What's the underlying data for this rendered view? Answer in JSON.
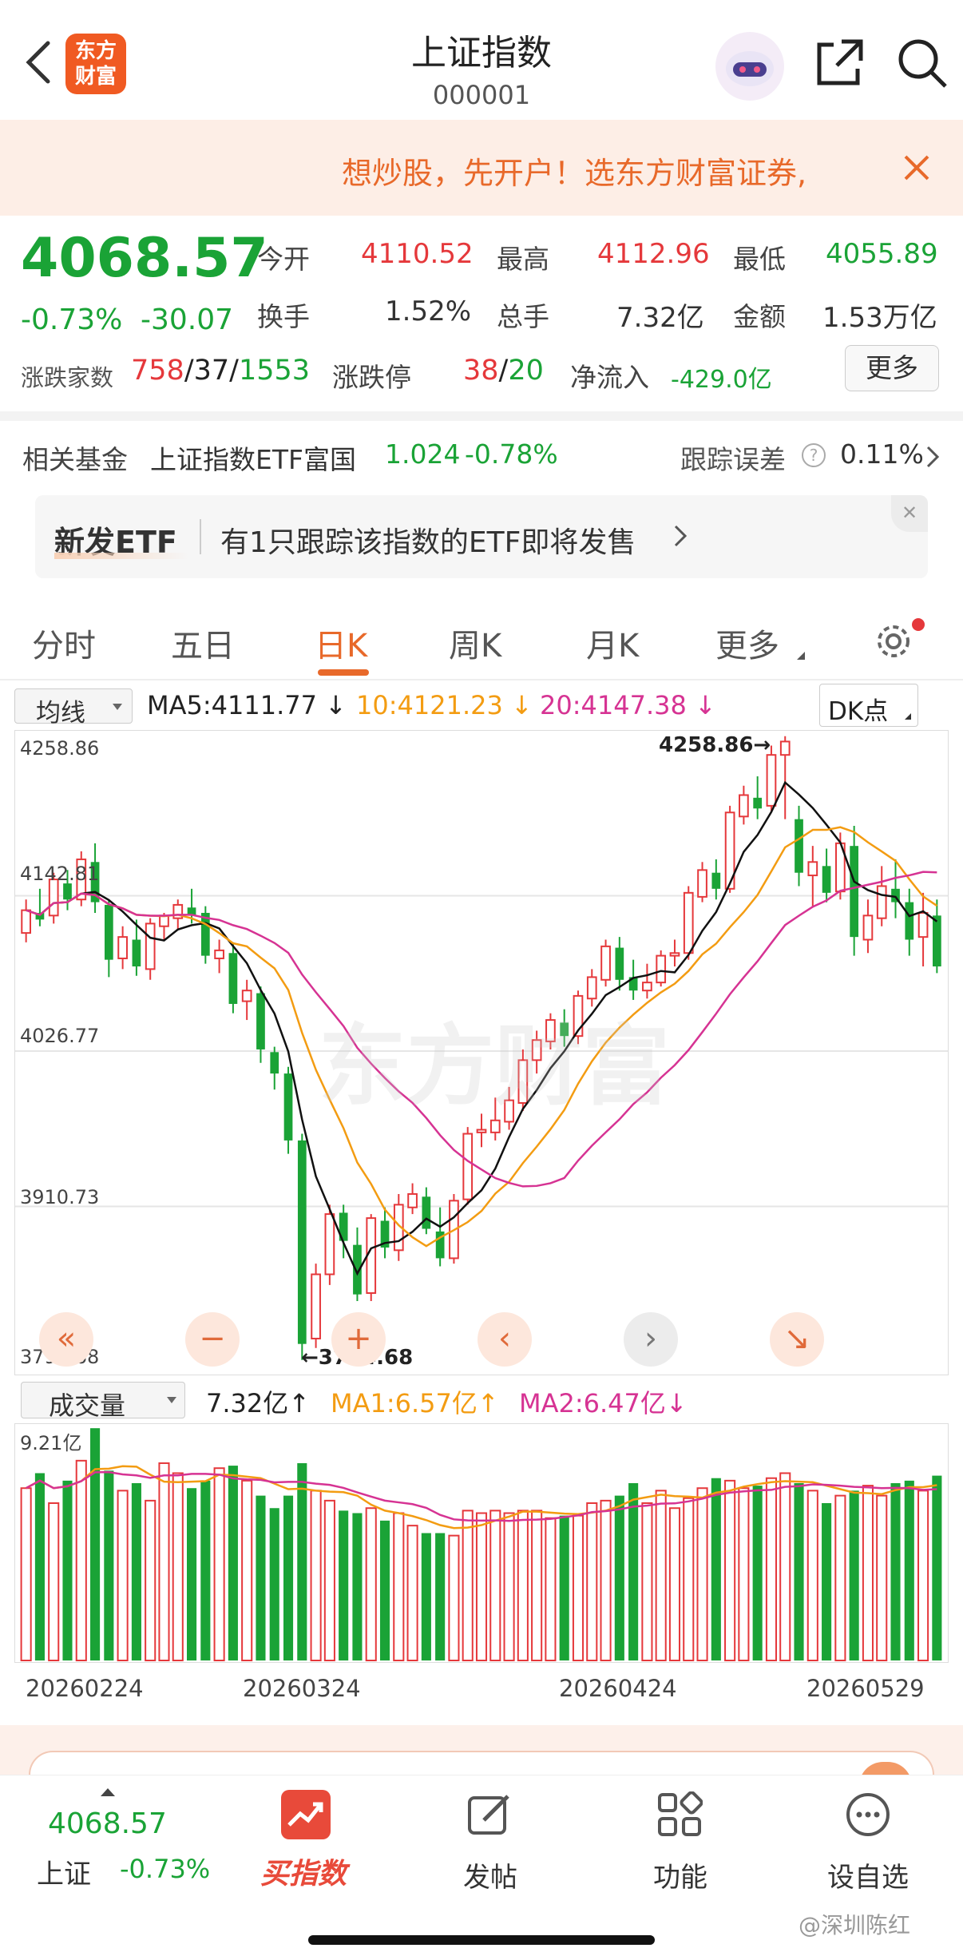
{
  "header": {
    "back_icon": "chevron-left-icon",
    "app_logo_text": "东方财富",
    "title": "上证指数",
    "code": "000001",
    "share_icon": "share-icon",
    "search_icon": "search-icon"
  },
  "banner": {
    "text": "想炒股，先开户！选东方财富证券,",
    "close_icon": "close-icon"
  },
  "quote": {
    "price": "4068.57",
    "change_pct": "-0.73%",
    "change": "-30.07",
    "open_label": "今开",
    "open": "4110.52",
    "high_label": "最高",
    "high": "4112.96",
    "low_label": "最低",
    "low": "4055.89",
    "turnover_label": "换手",
    "turnover": "1.52%",
    "volume_label": "总手",
    "volume": "7.32亿",
    "amount_label": "金额",
    "amount": "1.53万亿",
    "updown_label": "涨跌家数",
    "up_count": "758",
    "flat_count": "37",
    "down_count": "1553",
    "limit_label": "涨跌停",
    "limit_up": "38",
    "limit_down": "20",
    "netflow_label": "净流入",
    "netflow": "-429.0亿",
    "more_button": "更多",
    "slash": "/"
  },
  "fund": {
    "label": "相关基金",
    "name": "上证指数ETF富国",
    "price": "1.024",
    "change": "-0.78%",
    "tracking_label": "跟踪误差",
    "tracking_value": "0.11%"
  },
  "etf_card": {
    "tag": "新发ETF",
    "text": "有1只跟踪该指数的ETF即将发售"
  },
  "tabs": [
    {
      "label": "分时"
    },
    {
      "label": "五日"
    },
    {
      "label": "日K"
    },
    {
      "label": "周K"
    },
    {
      "label": "月K"
    },
    {
      "label": "更多"
    }
  ],
  "active_tab": "日K",
  "ma_bar": {
    "select_label": "均线",
    "ma5": "MA5:4111.77",
    "ma10": "10:4121.23",
    "ma20": "20:4147.38",
    "dk_label": "DK点"
  },
  "vol_bar": {
    "select_label": "成交量",
    "vol": "7.32亿",
    "ma1": "MA1:6.57亿",
    "ma2": "MA2:6.47亿"
  },
  "chart_controls": [
    "«",
    "−",
    "+",
    "‹",
    "›",
    "↘"
  ],
  "chart_data": [
    {
      "type": "candlestick",
      "y_ticks": [
        "4258.86",
        "4142.81",
        "4026.77",
        "3910.73",
        "3794.68"
      ],
      "ylim": [
        3794.68,
        4258.86
      ],
      "watermark": "东方财富",
      "high_marker": "4258.86",
      "low_marker": "3794.68",
      "candles": [
        [
          4115,
          4132,
          4140,
          4108
        ],
        [
          4130,
          4125,
          4148,
          4120
        ],
        [
          4128,
          4155,
          4160,
          4122
        ],
        [
          4152,
          4140,
          4162,
          4132
        ],
        [
          4140,
          4170,
          4176,
          4135
        ],
        [
          4168,
          4138,
          4182,
          4130
        ],
        [
          4136,
          4095,
          4140,
          4082
        ],
        [
          4096,
          4112,
          4120,
          4088
        ],
        [
          4110,
          4090,
          4125,
          4083
        ],
        [
          4088,
          4122,
          4126,
          4080
        ],
        [
          4120,
          4128,
          4130,
          4110
        ],
        [
          4126,
          4136,
          4140,
          4118
        ],
        [
          4134,
          4128,
          4148,
          4122
        ],
        [
          4130,
          4098,
          4135,
          4092
        ],
        [
          4096,
          4102,
          4110,
          4085
        ],
        [
          4100,
          4062,
          4108,
          4055
        ],
        [
          4064,
          4072,
          4080,
          4050
        ],
        [
          4070,
          4028,
          4075,
          4018
        ],
        [
          4026,
          4010,
          4030,
          3998
        ],
        [
          4010,
          3960,
          4015,
          3950
        ],
        [
          3960,
          3808,
          3965,
          3796
        ],
        [
          3812,
          3860,
          3868,
          3805
        ],
        [
          3860,
          3905,
          3912,
          3852
        ],
        [
          3906,
          3885,
          3912,
          3872
        ],
        [
          3882,
          3845,
          3895,
          3840
        ],
        [
          3846,
          3902,
          3905,
          3840
        ],
        [
          3900,
          3880,
          3910,
          3872
        ],
        [
          3878,
          3912,
          3920,
          3870
        ],
        [
          3910,
          3920,
          3928,
          3905
        ],
        [
          3918,
          3894,
          3925,
          3890
        ],
        [
          3892,
          3872,
          3910,
          3866
        ],
        [
          3872,
          3915,
          3920,
          3868
        ],
        [
          3916,
          3965,
          3970,
          3912
        ],
        [
          3966,
          3968,
          3980,
          3955
        ],
        [
          3966,
          3975,
          3992,
          3960
        ],
        [
          3974,
          3990,
          4000,
          3968
        ],
        [
          3988,
          4020,
          4028,
          3982
        ],
        [
          4020,
          4035,
          4042,
          4010
        ],
        [
          4034,
          4050,
          4055,
          4028
        ],
        [
          4048,
          4038,
          4058,
          4030
        ],
        [
          4038,
          4068,
          4072,
          4032
        ],
        [
          4066,
          4082,
          4088,
          4060
        ],
        [
          4080,
          4105,
          4110,
          4075
        ],
        [
          4104,
          4080,
          4112,
          4072
        ],
        [
          4082,
          4072,
          4095,
          4065
        ],
        [
          4072,
          4078,
          4092,
          4066
        ],
        [
          4078,
          4098,
          4102,
          4075
        ],
        [
          4098,
          4100,
          4110,
          4090
        ],
        [
          4100,
          4145,
          4150,
          4095
        ],
        [
          4142,
          4162,
          4168,
          4138
        ],
        [
          4160,
          4148,
          4170,
          4140
        ],
        [
          4148,
          4205,
          4210,
          4145
        ],
        [
          4202,
          4218,
          4225,
          4196
        ],
        [
          4216,
          4208,
          4232,
          4200
        ],
        [
          4210,
          4248,
          4255,
          4205
        ],
        [
          4248,
          4258,
          4262,
          4200
        ],
        [
          4200,
          4160,
          4210,
          4150
        ],
        [
          4158,
          4168,
          4180,
          4135
        ],
        [
          4165,
          4145,
          4178,
          4138
        ],
        [
          4146,
          4182,
          4190,
          4140
        ],
        [
          4180,
          4112,
          4195,
          4098
        ],
        [
          4110,
          4128,
          4140,
          4100
        ],
        [
          4126,
          4150,
          4165,
          4120
        ],
        [
          4148,
          4138,
          4170,
          4126
        ],
        [
          4138,
          4110,
          4148,
          4098
        ],
        [
          4112,
          4130,
          4145,
          4090
        ],
        [
          4128,
          4090,
          4140,
          4085
        ]
      ]
    },
    {
      "type": "bar",
      "y_ticks": [
        "9.21亿"
      ],
      "volumes": [
        6.9,
        7.5,
        6.3,
        7.2,
        8.0,
        9.3,
        7.6,
        6.8,
        7.1,
        6.4,
        7.9,
        7.5,
        6.9,
        7.2,
        7.7,
        7.8,
        7.2,
        6.6,
        6.1,
        6.6,
        7.9,
        6.8,
        6.4,
        6.0,
        5.9,
        6.1,
        5.6,
        5.9,
        5.4,
        5.1,
        5.1,
        5.0,
        6.0,
        5.9,
        6.0,
        5.9,
        6.0,
        6.0,
        5.7,
        5.8,
        5.8,
        6.3,
        6.4,
        6.6,
        7.1,
        6.3,
        6.8,
        6.1,
        6.5,
        6.9,
        7.3,
        7.2,
        6.9,
        7.0,
        7.3,
        7.5,
        7.1,
        6.8,
        6.3,
        6.6,
        6.8,
        7.0,
        6.6,
        7.1,
        7.2,
        6.8,
        7.4
      ]
    }
  ],
  "date_ticks": [
    "20260224",
    "20260324",
    "20260424",
    "20260529"
  ],
  "bottom_nav": {
    "index_price": "4068.57",
    "index_name": "上证",
    "index_change": "-0.73%",
    "buy_index": "买指数",
    "post": "发帖",
    "functions": "功能",
    "watchlist": "设自选"
  },
  "watermark_footer": "@深圳陈红"
}
